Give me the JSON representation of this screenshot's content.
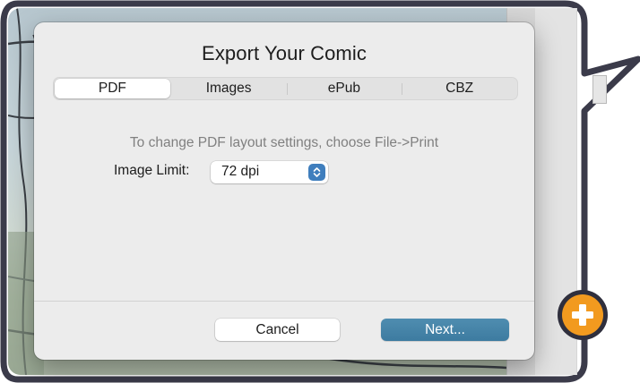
{
  "dialog": {
    "title": "Export Your Comic",
    "tabs": [
      {
        "label": "PDF",
        "selected": true
      },
      {
        "label": "Images",
        "selected": false
      },
      {
        "label": "ePub",
        "selected": false
      },
      {
        "label": "CBZ",
        "selected": false
      }
    ],
    "hint": "To change PDF layout settings, choose File->Print",
    "image_limit": {
      "label": "Image Limit:",
      "value": "72 dpi",
      "icon": "chevron-up-down-icon"
    },
    "buttons": {
      "cancel": "Cancel",
      "next": "Next..."
    }
  },
  "add_button": {
    "icon": "plus-icon"
  },
  "colors": {
    "frame": "#3b3b4a",
    "accent_button": "#4583a8",
    "popup_arrow": "#3f7ebd",
    "add_button": "#f29a1f"
  }
}
